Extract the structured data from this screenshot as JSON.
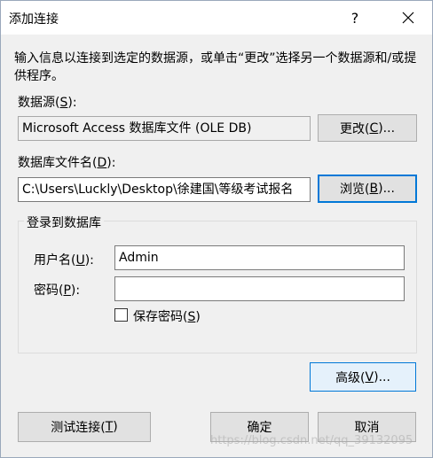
{
  "window": {
    "title": "添加连接",
    "help_glyph": "?",
    "close_icon": "close-icon"
  },
  "description": "输入信息以连接到选定的数据源，或单击“更改”选择另一个数据源和/或提供程序。",
  "datasource": {
    "label_prefix": "数据源(",
    "label_key": "S",
    "label_suffix": "):",
    "value": "Microsoft Access 数据库文件 (OLE DB)",
    "change_prefix": "更改(",
    "change_key": "C",
    "change_suffix": ")..."
  },
  "database_file": {
    "label_prefix": "数据库文件名(",
    "label_key": "D",
    "label_suffix": "):",
    "value": "C:\\Users\\Luckly\\Desktop\\徐建国\\等级考试报名",
    "browse_prefix": "浏览(",
    "browse_key": "B",
    "browse_suffix": ")..."
  },
  "login": {
    "group_title": "登录到数据库",
    "username_prefix": "用户名(",
    "username_key": "U",
    "username_suffix": "):",
    "username_value": "Admin",
    "password_prefix": "密码(",
    "password_key": "P",
    "password_suffix": "):",
    "password_value": "",
    "save_password_prefix": "保存密码(",
    "save_password_key": "S",
    "save_password_suffix": ")",
    "save_password_checked": false
  },
  "advanced": {
    "prefix": "高级(",
    "key": "V",
    "suffix": ")..."
  },
  "footer": {
    "test_prefix": "测试连接(",
    "test_key": "T",
    "test_suffix": ")",
    "ok_label": "确定",
    "cancel_label": "取消"
  },
  "watermark": "https://blog.csdn.net/qq_39132095",
  "colors": {
    "focus_border": "#0078d7",
    "hover_fill": "#e5f1fb",
    "button_fill": "#e1e1e1",
    "dialog_bg": "#f0f0f0"
  }
}
